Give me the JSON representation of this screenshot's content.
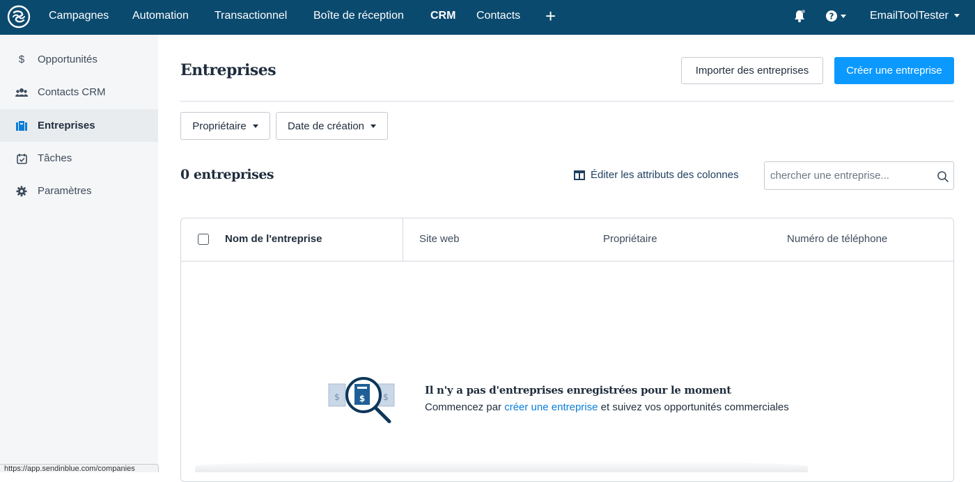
{
  "nav": {
    "items": [
      {
        "label": "Campagnes"
      },
      {
        "label": "Automation"
      },
      {
        "label": "Transactionnel"
      },
      {
        "label": "Boîte de réception"
      },
      {
        "label": "CRM"
      },
      {
        "label": "Contacts"
      }
    ],
    "active": "CRM",
    "user": "EmailToolTester"
  },
  "sidebar": {
    "items": [
      {
        "label": "Opportunités",
        "icon": "dollar-icon"
      },
      {
        "label": "Contacts CRM",
        "icon": "users-icon"
      },
      {
        "label": "Entreprises",
        "icon": "building-icon"
      },
      {
        "label": "Tâches",
        "icon": "calendar-check-icon"
      },
      {
        "label": "Paramètres",
        "icon": "gear-icon"
      }
    ],
    "active": "Entreprises"
  },
  "page": {
    "title": "Entreprises",
    "import_button": "Importer des entreprises",
    "create_button": "Créer une entreprise",
    "filters": {
      "owner": "Propriétaire",
      "created": "Date de création"
    },
    "count": "0 entreprises",
    "edit_columns": "Éditer les attributs des colonnes",
    "search_placeholder": "chercher une entreprise..."
  },
  "table": {
    "columns": [
      "Nom de l'entreprise",
      "Site web",
      "Propriétaire",
      "Numéro de téléphone"
    ]
  },
  "empty": {
    "title": "Il n'y a pas d'entreprises enregistrées pour le moment",
    "text_before": "Commencez par ",
    "link": "créer une entreprise",
    "text_after": " et suivez vos opportunités commerciales"
  },
  "status_bar": {
    "url": "https://app.sendinblue.com/companies"
  },
  "colors": {
    "topbar": "#0b4a6f",
    "primary": "#0b99ff",
    "link": "#0b7dd8"
  }
}
